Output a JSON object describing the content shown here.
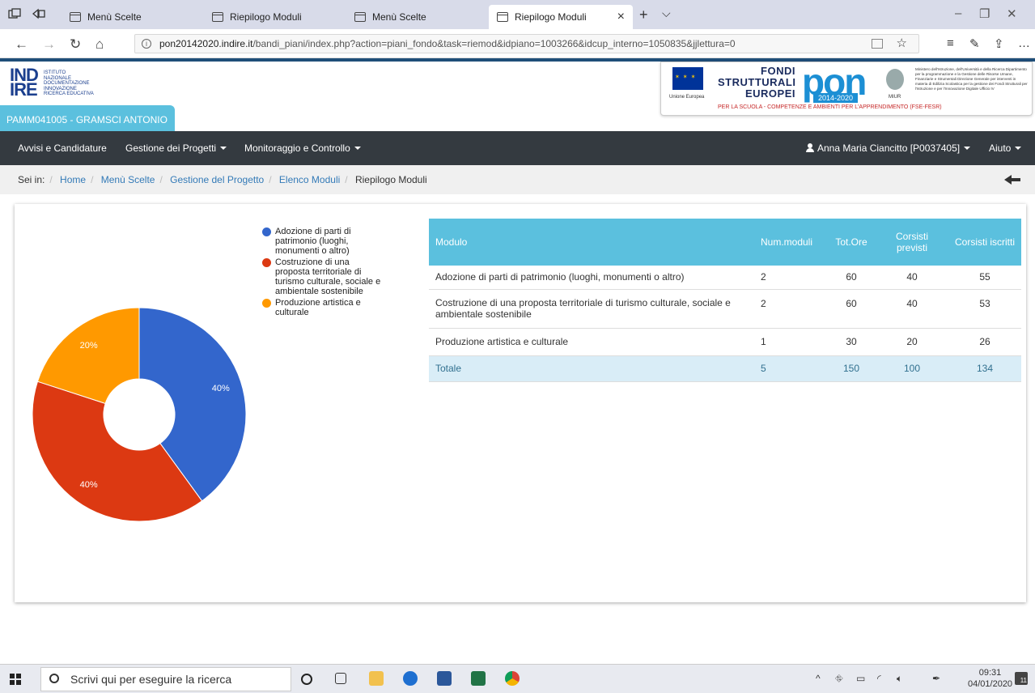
{
  "browser": {
    "tabs": [
      {
        "title": "Menù Scelte"
      },
      {
        "title": "Riepilogo Moduli"
      },
      {
        "title": "Menù Scelte"
      },
      {
        "title": "Riepilogo Moduli"
      }
    ],
    "url_prefix": "pon20142020.indire.it",
    "url_path": "/bandi_piani/index.php?action=piani_fondo&task=riemod&idpiano=1003266&idcup_interno=1050835&jjlettura=0"
  },
  "header": {
    "logo_main": "IND IRE",
    "logo_lines": [
      "ISTITUTO",
      "NAZIONALE",
      "DOCUMENTAZIONE",
      "INNOVAZIONE",
      "RICERCA EDUCATIVA"
    ],
    "school": "PAMM041005 - GRAMSCI ANTONIO",
    "eu_caption": "Unione Europea",
    "fondi": "FONDI STRUTTURALI EUROPEI",
    "pon": "pon",
    "pon_years": "2014-2020",
    "pon_sub": "PER LA SCUOLA - COMPETENZE E AMBIENTI PER L'APPRENDIMENTO (FSE-FESR)",
    "miur_caption": "MIUR",
    "miur_text": "Ministero dell'Istruzione, dell'Università e della Ricerca Dipartimento per la programmazione e la Gestione delle Risorse Umane, Finanziarie e Strumentali Direzione Generale per interventi in materia di Edilizia Scolastica per la gestione dei Fondi Strutturali per l'Istruzione e per l'Innovazione Digitale Ufficio IV"
  },
  "nav": {
    "items": [
      "Avvisi e Candidature",
      "Gestione dei Progetti",
      "Monitoraggio e Controllo"
    ],
    "user": "Anna Maria Ciancitto [P0037405]",
    "help": "Aiuto"
  },
  "breadcrumb": {
    "label": "Sei in:",
    "items": [
      "Home",
      "Menù Scelte",
      "Gestione del Progetto",
      "Elenco Moduli"
    ],
    "current": "Riepilogo Moduli"
  },
  "chart_data": {
    "type": "pie",
    "donut": true,
    "legend_position": "right",
    "categories": [
      "Adozione di parti di patrimonio (luoghi, monumenti o altro)",
      "Costruzione di una proposta territoriale di turismo culturale, sociale e ambientale sostenibile",
      "Produzione artistica e culturale"
    ],
    "values": [
      40,
      40,
      20
    ],
    "labels": [
      "40%",
      "40%",
      "20%"
    ],
    "colors": [
      "#3366cc",
      "#dc3912",
      "#ff9900"
    ]
  },
  "table": {
    "headers": [
      "Modulo",
      "Num.moduli",
      "Tot.Ore",
      "Corsisti previsti",
      "Corsisti iscritti"
    ],
    "rows": [
      [
        "Adozione di parti di patrimonio (luoghi, monumenti o altro)",
        "2",
        "60",
        "40",
        "55"
      ],
      [
        "Costruzione di una proposta territoriale di turismo culturale, sociale e ambientale sostenibile",
        "2",
        "60",
        "40",
        "53"
      ],
      [
        "Produzione artistica e culturale",
        "1",
        "30",
        "20",
        "26"
      ]
    ],
    "total": [
      "Totale",
      "5",
      "150",
      "100",
      "134"
    ]
  },
  "taskbar": {
    "search_placeholder": "Scrivi qui per eseguire la ricerca",
    "time": "09:31",
    "date": "04/01/2020",
    "notif_count": "11"
  }
}
